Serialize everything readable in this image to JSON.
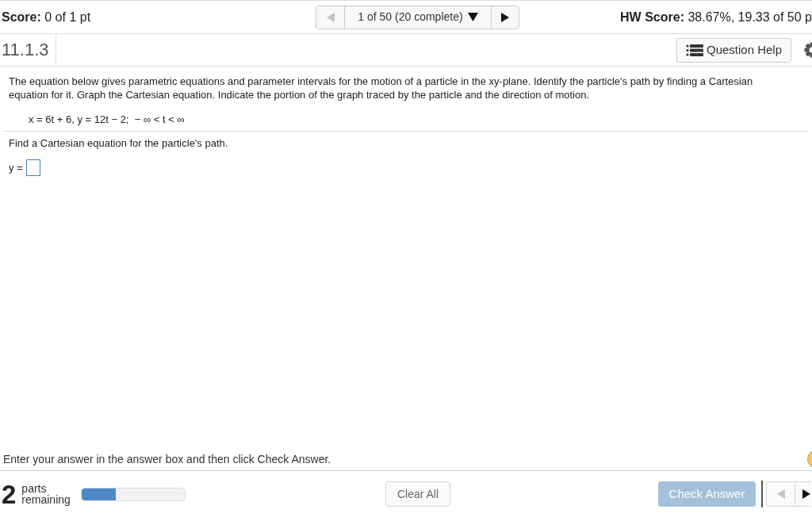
{
  "header": {
    "score": {
      "label": "Score:",
      "value": "0 of 1 pt"
    },
    "question_nav": {
      "previous": {
        "disabled": true
      },
      "position": "1 of 50 (20 complete)",
      "next": {
        "disabled": false
      }
    },
    "hw_score": {
      "label": "HW Score:",
      "value": "38.67%, 19.33 of 50 p"
    }
  },
  "question_bar": {
    "number": "11.1.3",
    "help_button": "Question Help"
  },
  "question": {
    "prompt": "The equation below gives parametric equations and parameter intervals for the motion of a particle in the xy-plane. Identify the particle's path by finding a Cartesian equation for it. Graph the Cartesian equation. Indicate the portion of the graph traced by the particle and the direction of motion.",
    "equation": "x = 6t + 6, y = 12t − 2;  − ∞ < t < ∞",
    "part_prompt": "Find a Cartesian equation for the particle's path.",
    "answer": {
      "label": "y ="
    }
  },
  "footer": {
    "instruction": "Enter your answer in the answer box and then click Check Answer.",
    "parts_remaining": {
      "count": "2",
      "label": "parts remaining",
      "level": 0.33
    },
    "clear_button": {
      "label": "Clear All"
    },
    "check_button": {
      "label": "Check Answer",
      "disabled": true
    },
    "question_nav": {
      "previous": {
        "disabled": true
      },
      "next": {
        "disabled": false
      }
    }
  }
}
